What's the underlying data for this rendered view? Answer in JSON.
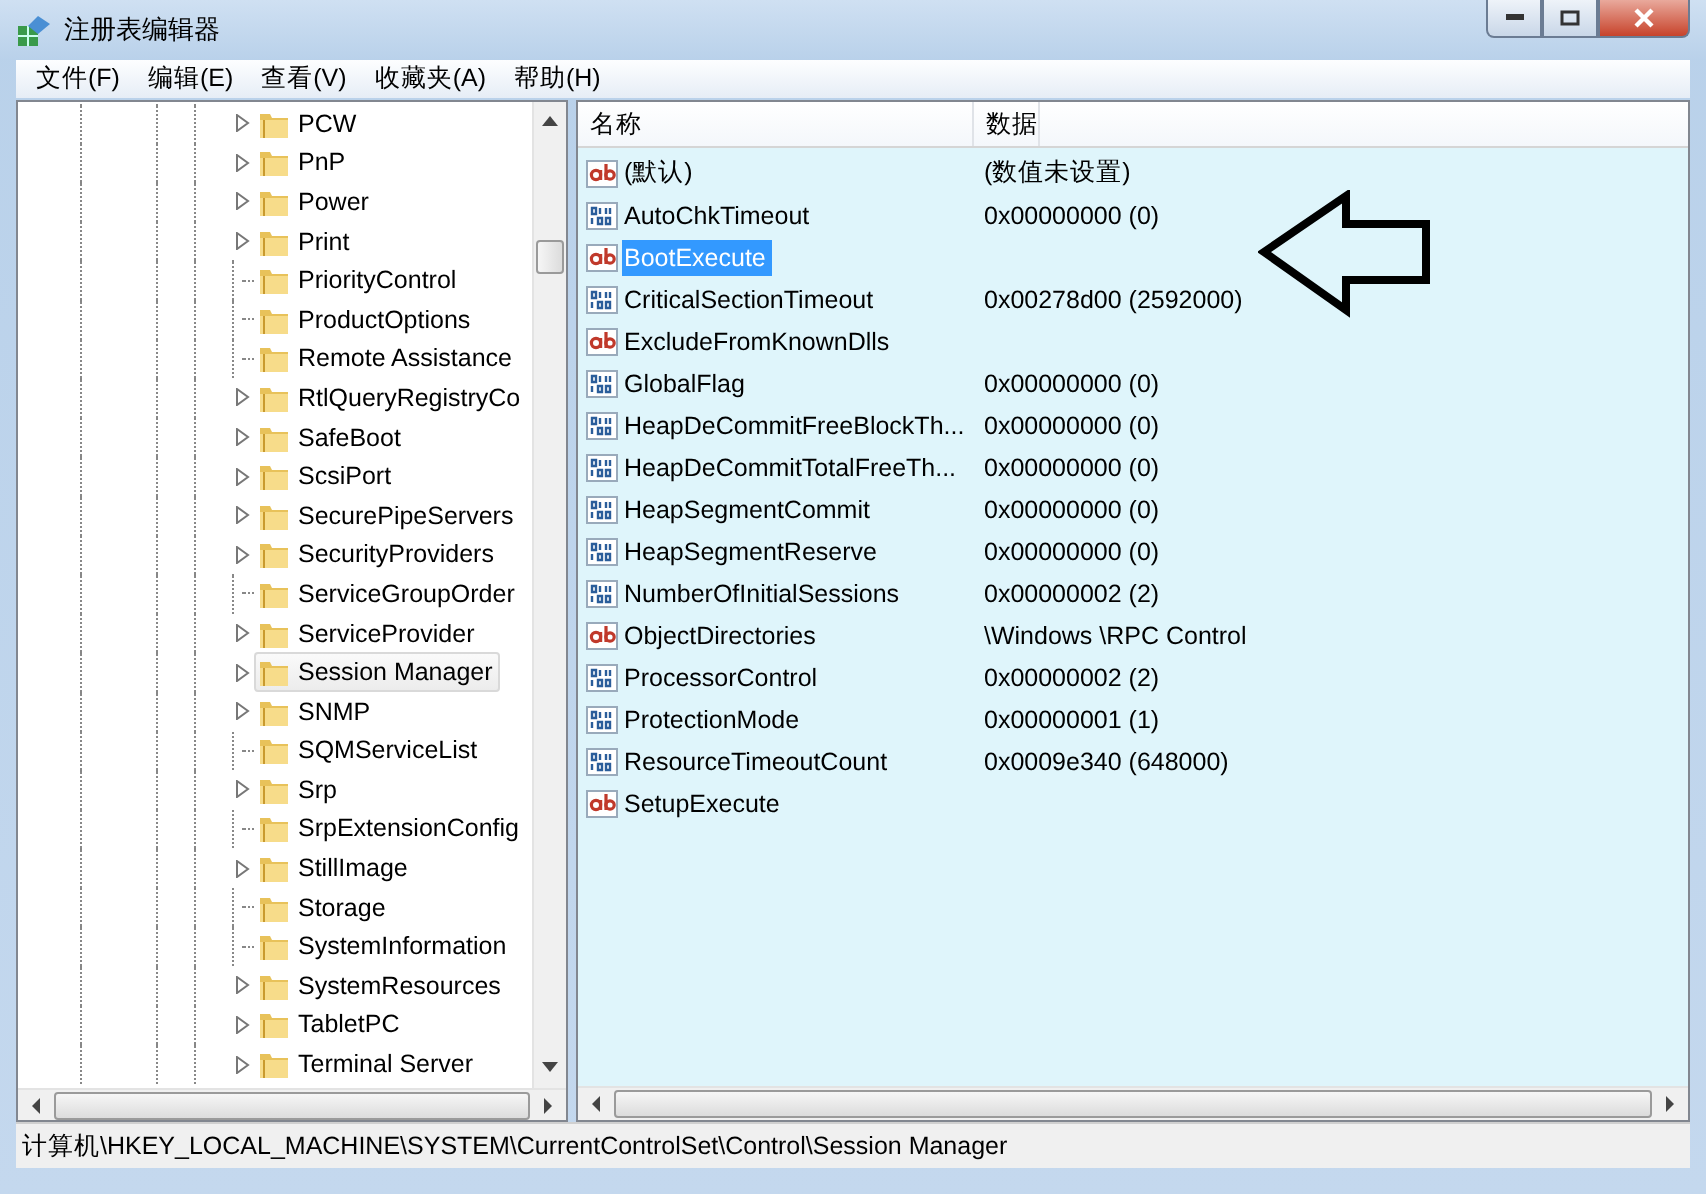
{
  "window": {
    "title": "注册表编辑器"
  },
  "menu": [
    {
      "label": "文件(F)"
    },
    {
      "label": "编辑(E)"
    },
    {
      "label": "查看(V)"
    },
    {
      "label": "收藏夹(A)"
    },
    {
      "label": "帮助(H)"
    }
  ],
  "tree": {
    "items": [
      {
        "label": "PCW",
        "expandable": true,
        "selected": false
      },
      {
        "label": "PnP",
        "expandable": true,
        "selected": false
      },
      {
        "label": "Power",
        "expandable": true,
        "selected": false
      },
      {
        "label": "Print",
        "expandable": true,
        "selected": false
      },
      {
        "label": "PriorityControl",
        "expandable": false,
        "selected": false
      },
      {
        "label": "ProductOptions",
        "expandable": false,
        "selected": false
      },
      {
        "label": "Remote Assistance",
        "expandable": false,
        "selected": false
      },
      {
        "label": "RtlQueryRegistryCo",
        "expandable": true,
        "selected": false
      },
      {
        "label": "SafeBoot",
        "expandable": true,
        "selected": false
      },
      {
        "label": "ScsiPort",
        "expandable": true,
        "selected": false
      },
      {
        "label": "SecurePipeServers",
        "expandable": true,
        "selected": false
      },
      {
        "label": "SecurityProviders",
        "expandable": true,
        "selected": false
      },
      {
        "label": "ServiceGroupOrder",
        "expandable": false,
        "selected": false
      },
      {
        "label": "ServiceProvider",
        "expandable": true,
        "selected": false
      },
      {
        "label": "Session Manager",
        "expandable": true,
        "selected": true
      },
      {
        "label": "SNMP",
        "expandable": true,
        "selected": false
      },
      {
        "label": "SQMServiceList",
        "expandable": false,
        "selected": false
      },
      {
        "label": "Srp",
        "expandable": true,
        "selected": false
      },
      {
        "label": "SrpExtensionConfig",
        "expandable": false,
        "selected": false
      },
      {
        "label": "StillImage",
        "expandable": true,
        "selected": false
      },
      {
        "label": "Storage",
        "expandable": false,
        "selected": false
      },
      {
        "label": "SystemInformation",
        "expandable": false,
        "selected": false
      },
      {
        "label": "SystemResources",
        "expandable": true,
        "selected": false
      },
      {
        "label": "TabletPC",
        "expandable": true,
        "selected": false
      },
      {
        "label": "Terminal Server",
        "expandable": true,
        "selected": false
      }
    ]
  },
  "list": {
    "columns": [
      "名称",
      "数据"
    ],
    "rows": [
      {
        "kind": "string",
        "name": "(默认)",
        "data": "(数值未设置)",
        "selected": false
      },
      {
        "kind": "number",
        "name": "AutoChkTimeout",
        "data": "0x00000000 (0)",
        "selected": false
      },
      {
        "kind": "string",
        "name": "BootExecute",
        "selected": true
      },
      {
        "kind": "number",
        "name": "CriticalSectionTimeout",
        "data": "0x00278d00 (2592000)",
        "selected": false
      },
      {
        "kind": "string",
        "name": "ExcludeFromKnownDlls",
        "selected": false
      },
      {
        "kind": "number",
        "name": "GlobalFlag",
        "data": "0x00000000 (0)",
        "selected": false
      },
      {
        "kind": "number",
        "name": "HeapDeCommitFreeBlockTh...",
        "data": "0x00000000 (0)",
        "selected": false
      },
      {
        "kind": "number",
        "name": "HeapDeCommitTotalFreeTh...",
        "data": "0x00000000 (0)",
        "selected": false
      },
      {
        "kind": "number",
        "name": "HeapSegmentCommit",
        "data": "0x00000000 (0)",
        "selected": false
      },
      {
        "kind": "number",
        "name": "HeapSegmentReserve",
        "data": "0x00000000 (0)",
        "selected": false
      },
      {
        "kind": "number",
        "name": "NumberOfInitialSessions",
        "data": "0x00000002 (2)",
        "selected": false
      },
      {
        "kind": "string",
        "name": "ObjectDirectories",
        "data": "\\Windows \\RPC Control",
        "selected": false
      },
      {
        "kind": "number",
        "name": "ProcessorControl",
        "data": "0x00000002 (2)",
        "selected": false
      },
      {
        "kind": "number",
        "name": "ProtectionMode",
        "data": "0x00000001 (1)",
        "selected": false
      },
      {
        "kind": "number",
        "name": "ResourceTimeoutCount",
        "data": "0x0009e340 (648000)",
        "selected": false
      },
      {
        "kind": "string",
        "name": "SetupExecute",
        "selected": false
      }
    ]
  },
  "status_bar": {
    "path": "计算机\\HKEY_LOCAL_MACHINE\\SYSTEM\\CurrentControlSet\\Control\\Session Manager"
  }
}
